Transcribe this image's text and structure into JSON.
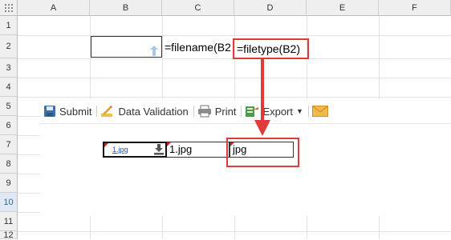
{
  "sheet": {
    "corner_icon": "select-all-grid-icon",
    "columns": [
      "A",
      "B",
      "C",
      "D",
      "E",
      "F"
    ],
    "rows": [
      "1",
      "2",
      "3",
      "4",
      "5",
      "6",
      "7",
      "8",
      "9",
      "10",
      "11",
      "12"
    ],
    "selected_row": "10",
    "cells": {
      "C2": "=filename(B2",
      "D2": "=filetype(B2)"
    },
    "b2_icon": "upload-arrow-icon"
  },
  "toolbar": {
    "submit_label": "Submit",
    "submit_icon": "floppy-disk-icon",
    "validation_label": "Data Validation",
    "validation_icon": "pencil-ruler-icon",
    "print_label": "Print",
    "print_icon": "printer-icon",
    "export_label": "Export",
    "export_icon": "export-sheet-icon",
    "mail_icon": "envelope-icon"
  },
  "preview": {
    "file_link": "1.jpg",
    "download_icon": "download-icon",
    "filename_value": "1.jpg",
    "filetype_value": "jpg"
  },
  "colors": {
    "highlight_red": "#e03a3a",
    "header_bg": "#efefef",
    "selected_header_bg": "#dfe8f4"
  }
}
